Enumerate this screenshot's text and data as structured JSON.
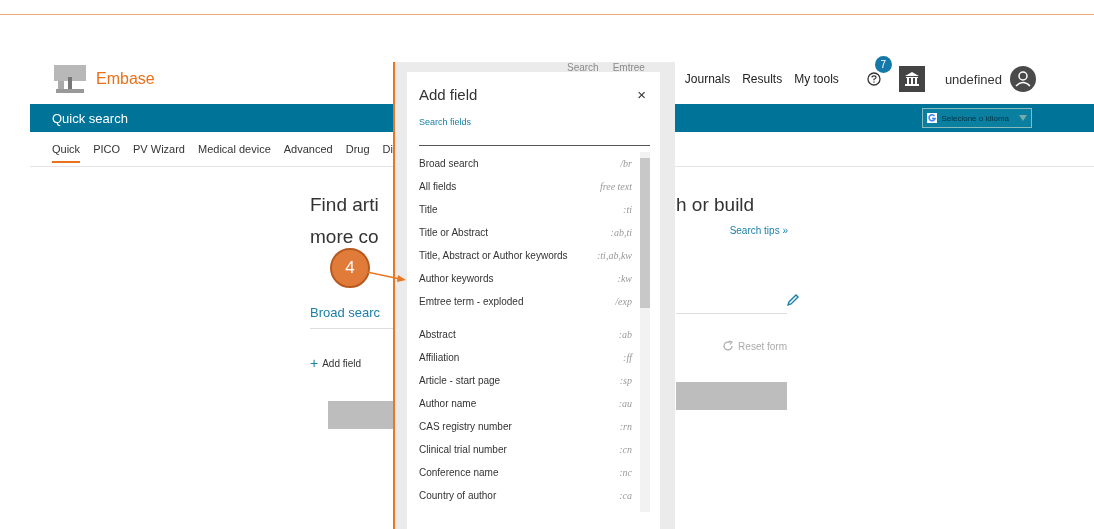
{
  "header": {
    "logo_text": "Embase",
    "faint_nav": [
      "Search",
      "Emtree"
    ],
    "nav": [
      "Journals",
      "Results",
      "My tools"
    ],
    "notification_count": "7",
    "user": "undefined"
  },
  "banner": {
    "title": "Quick search",
    "translate": "Selecione o idioma"
  },
  "tabs": [
    {
      "label": "Quick",
      "selected": true
    },
    {
      "label": "PICO",
      "selected": false
    },
    {
      "label": "PV Wizard",
      "selected": false
    },
    {
      "label": "Medical device",
      "selected": false
    },
    {
      "label": "Advanced",
      "selected": false
    },
    {
      "label": "Drug",
      "selected": false
    },
    {
      "label": "Di",
      "selected": false
    }
  ],
  "main": {
    "heading_left": [
      "Find arti",
      "more co"
    ],
    "heading_right": [
      "h or build"
    ],
    "search_tips": "Search tips »",
    "field_label": "Broad searc",
    "add_field_plus": "+",
    "add_field": "Add field",
    "reset": "Reset form"
  },
  "dialog": {
    "title": "Add field",
    "close": "×",
    "search_label": "Search fields",
    "groups": [
      [
        {
          "label": "Broad search",
          "code": "/br"
        },
        {
          "label": "All fields",
          "code": "free text"
        },
        {
          "label": "Title",
          "code": ":ti"
        },
        {
          "label": "Title or Abstract",
          "code": ":ab,ti"
        },
        {
          "label": "Title, Abstract or Author keywords",
          "code": ":ti,ab,kw"
        },
        {
          "label": "Author keywords",
          "code": ":kw"
        },
        {
          "label": "Emtree term - exploded",
          "code": "/exp"
        }
      ],
      [
        {
          "label": "Abstract",
          "code": ":ab"
        },
        {
          "label": "Affiliation",
          "code": ":ff"
        },
        {
          "label": "Article - start page",
          "code": ":sp"
        },
        {
          "label": "Author name",
          "code": ":au"
        },
        {
          "label": "CAS registry number",
          "code": ":rn"
        },
        {
          "label": "Clinical trial number",
          "code": ":cn"
        },
        {
          "label": "Conference name",
          "code": ":nc"
        },
        {
          "label": "Country of author",
          "code": ":ca"
        }
      ]
    ]
  },
  "callout": {
    "number": "4"
  }
}
